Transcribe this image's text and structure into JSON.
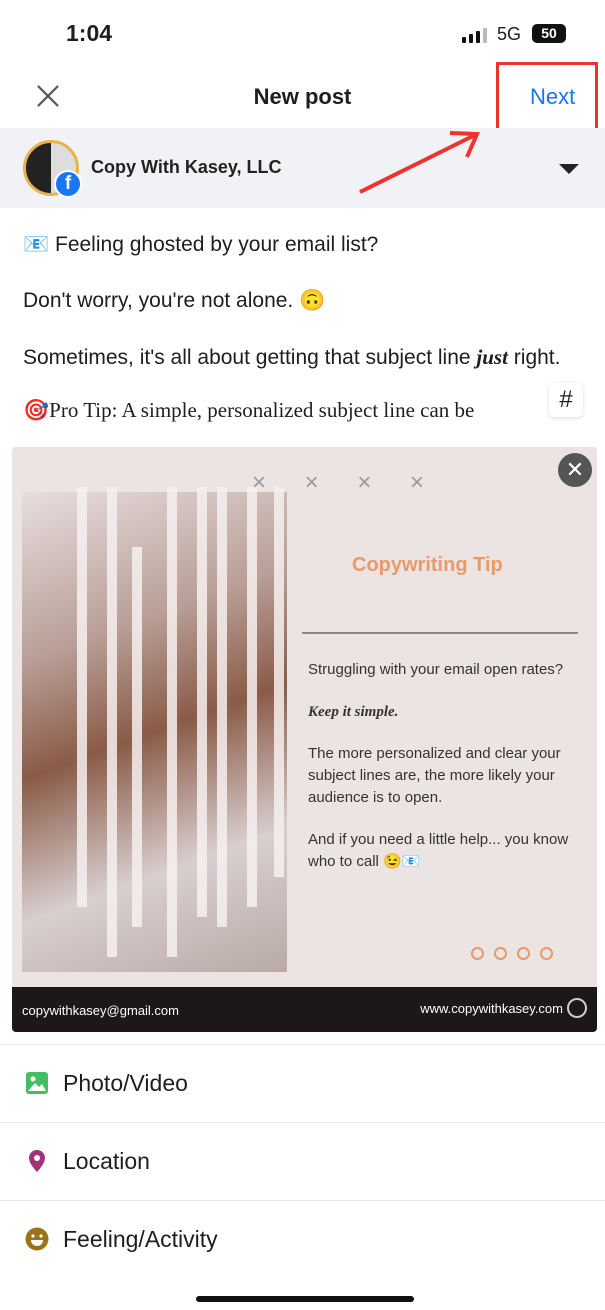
{
  "status_bar": {
    "time": "1:04",
    "network": "5G",
    "battery": "50"
  },
  "header": {
    "title": "New post",
    "next_label": "Next",
    "close_icon": "close-icon"
  },
  "account": {
    "name": "Copy With Kasey, LLC",
    "badge_icon": "facebook-icon",
    "dropdown_icon": "caret-down-icon"
  },
  "annotation": {
    "highlight_color": "#f0322c"
  },
  "post_text": {
    "line1_emoji": "📧",
    "line1": "Feeling ghosted by your email list?",
    "line2": "Don't worry, you're not alone.",
    "line2_emoji": "🙃",
    "line3a": "Sometimes, it's all about getting that subject line ",
    "line3_em": "just",
    "line3b": " right.",
    "line4_emoji": "🎯",
    "line4": "Pro Tip: A simple, personalized subject line can be"
  },
  "hashtag_button": "#",
  "image_card": {
    "decor_x": "× × × ×",
    "title": "Copywriting Tip",
    "p1": "Struggling with your email open rates?",
    "p2": "Keep it simple.",
    "p3": "The more personalized and clear your subject lines are, the more likely your audience is to open.",
    "p4": "And if you need a little help... you know who to call 😉📧",
    "email": "copywithkasey@gmail.com",
    "website": "www.copywithkasey.com",
    "accent": "#e79a6a"
  },
  "options": [
    {
      "label": "Photo/Video",
      "icon": "photo-icon",
      "color": "#45bd62"
    },
    {
      "label": "Location",
      "icon": "location-pin-icon",
      "color": "#a0337a"
    },
    {
      "label": "Feeling/Activity",
      "icon": "smiley-icon",
      "color": "#9a7416"
    }
  ],
  "accent_color": "#1877f2"
}
